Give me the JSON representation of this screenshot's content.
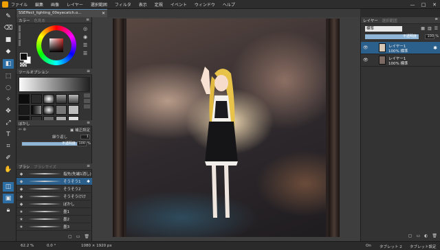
{
  "menu": [
    "ファイル",
    "編集",
    "画像",
    "レイヤー",
    "選択範囲",
    "フィルタ",
    "表示",
    "定規",
    "イベント",
    "ウィンドウ",
    "ヘルプ"
  ],
  "window_buttons": [
    "—",
    "□",
    "✕"
  ],
  "document_tab": {
    "title": "SSEffect_lighting_00eyecatch.o...",
    "close": "✕"
  },
  "color_panel": {
    "title": "カラー",
    "secondary": "色見本"
  },
  "tool_option": {
    "title": "ツールオプション"
  },
  "blur_panel": {
    "title": "ぼかし",
    "correction": "補正設定",
    "repeat_label": "繰り返し",
    "repeat_value": "1",
    "opacity_label": "不透明度",
    "opacity_value": "100",
    "opacity_unit": "%"
  },
  "brush_panel": {
    "tabs": [
      "ブラシ",
      "ブラシサイズ"
    ],
    "items": [
      "指先(先端1消し)",
      "そうそう1",
      "そうそう2",
      "そうそうけけ",
      "ぼかし",
      "墨1",
      "墨2",
      "墨3"
    ],
    "selected_index": 1
  },
  "layer_panel": {
    "tab": "レイヤー",
    "secondary": "選択範囲",
    "blend_mode": "標準",
    "opacity_label": "不透明度",
    "opacity_value": "100",
    "opacity_unit": "%",
    "layers": [
      {
        "name": "レイヤー1",
        "detail": "100% 標準",
        "selected": true
      },
      {
        "name": "レイヤー1",
        "detail": "100% 標準",
        "selected": false
      }
    ]
  },
  "status": {
    "zoom": "62.2 %",
    "angle": "0.0 °",
    "size": "1080 × 1920 px",
    "pen": "On",
    "tablet1": "タブレット 2",
    "tablet2": "タブレット設定"
  },
  "colors": {
    "accent": "#2c6da4",
    "selection": "#2b5f8c",
    "slider": "#8fb6d7",
    "panel": "#333333"
  }
}
